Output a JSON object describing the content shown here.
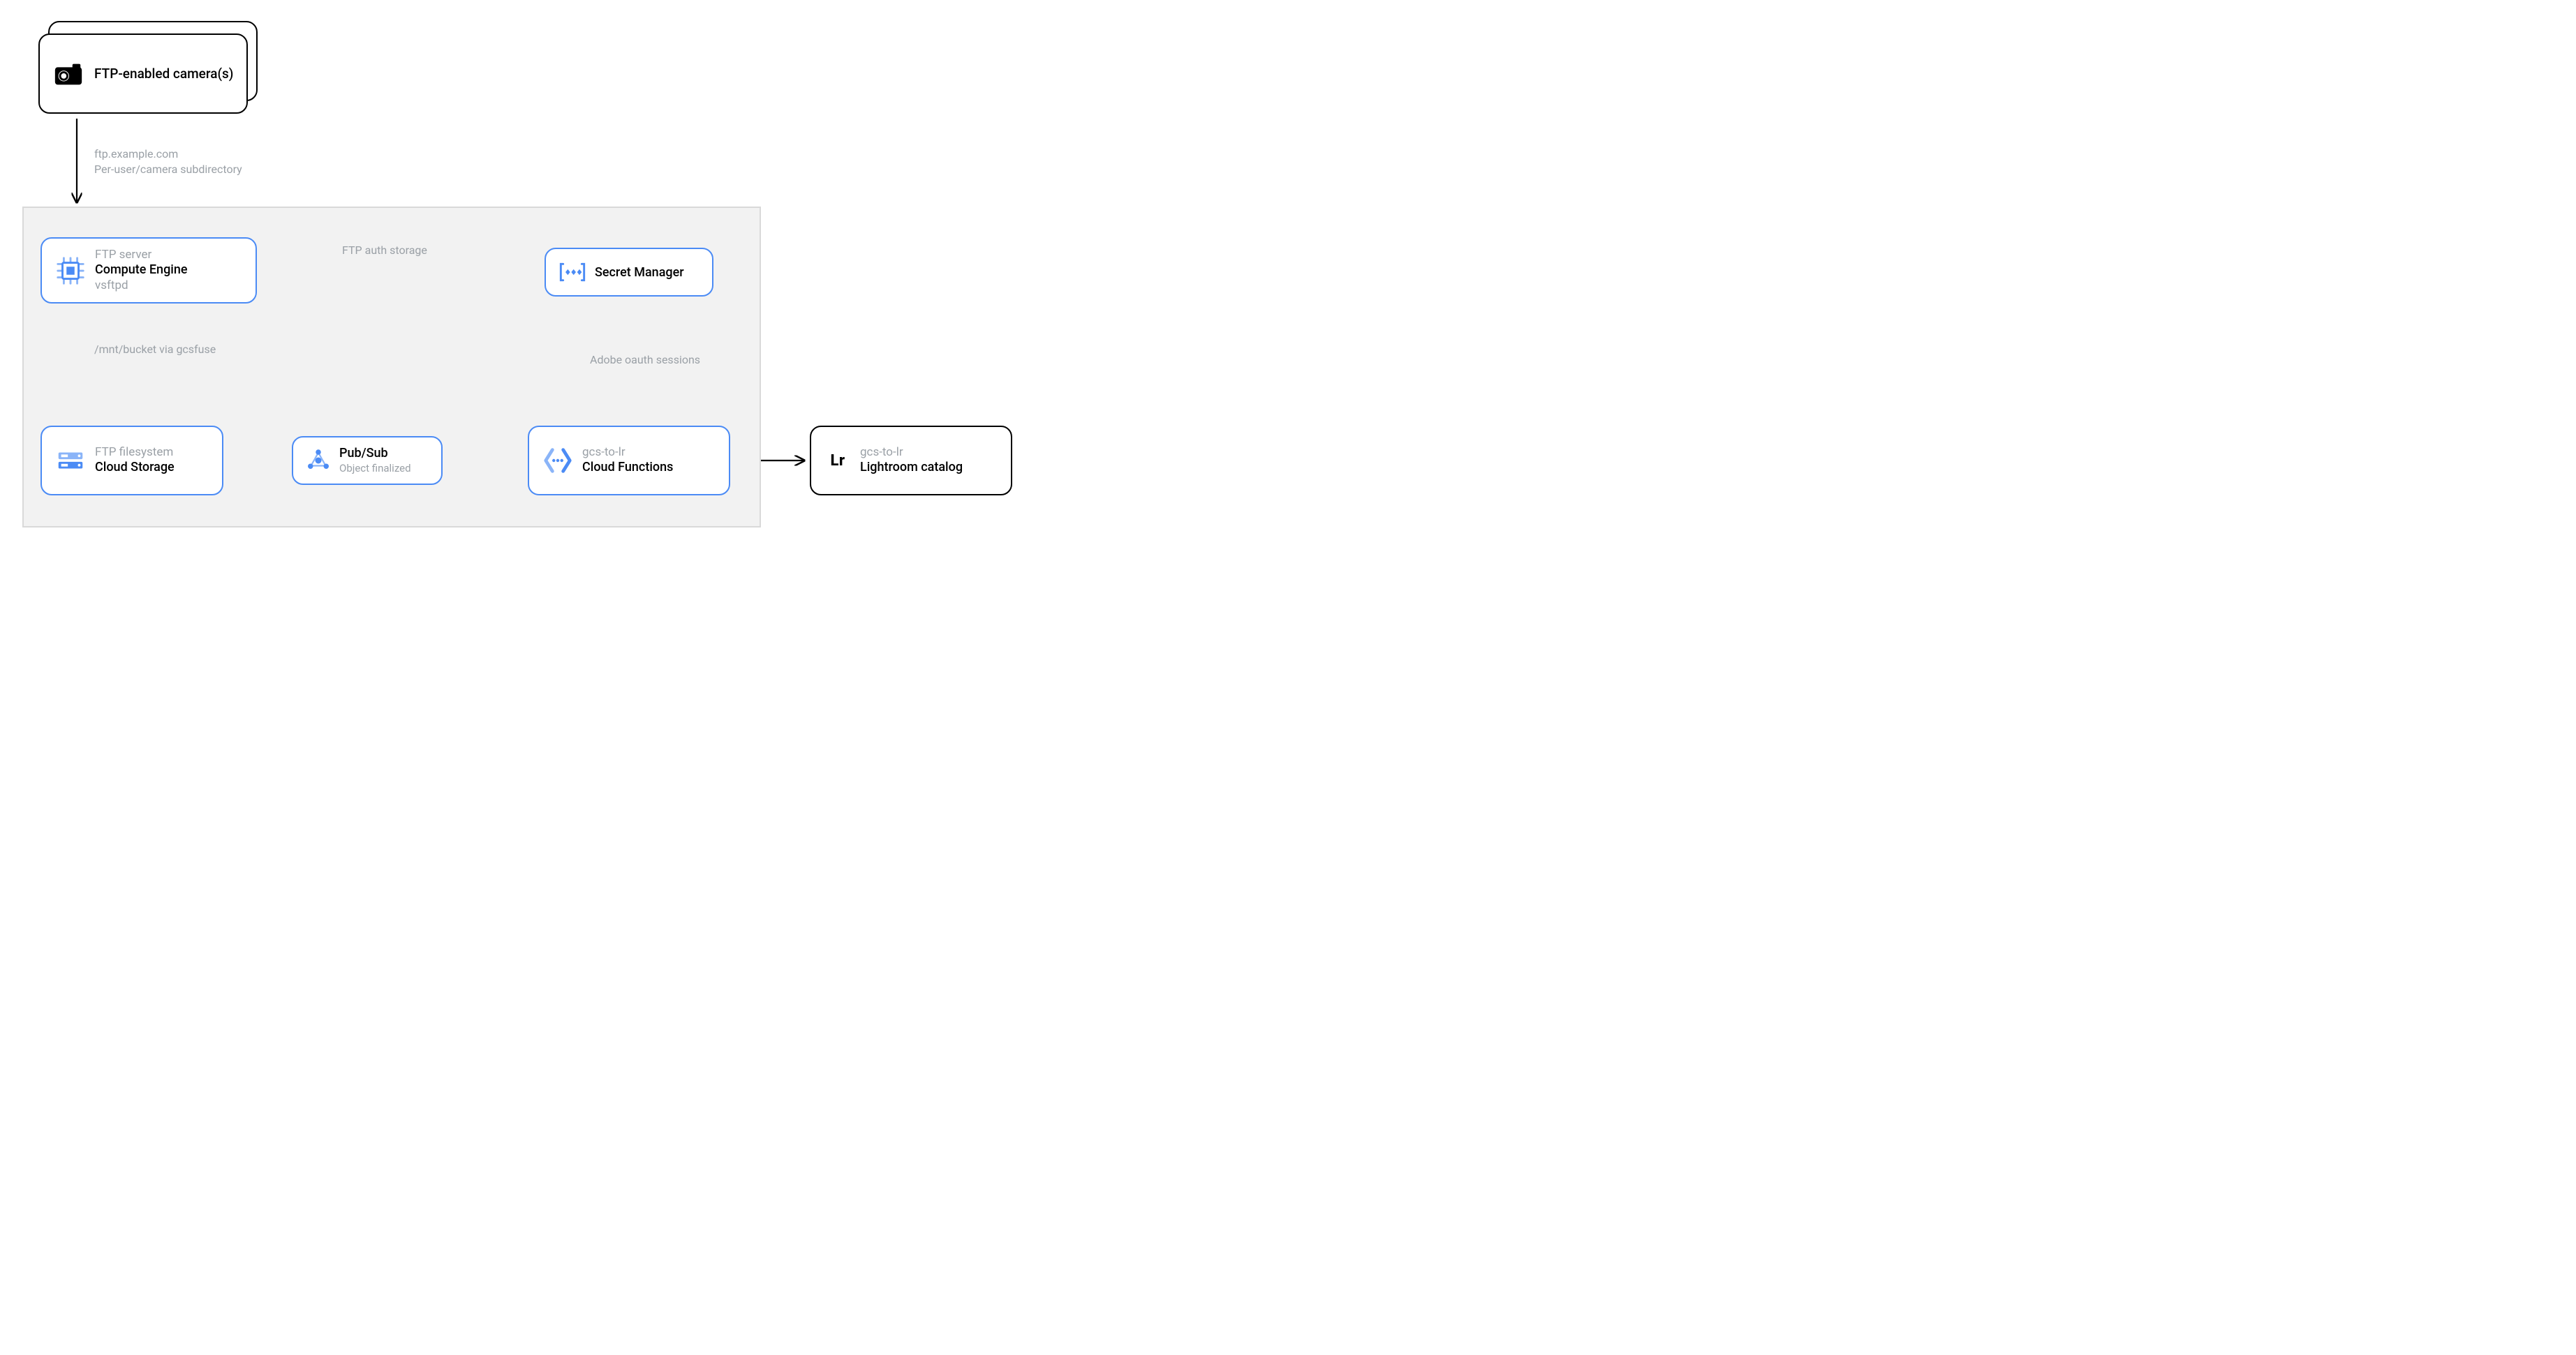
{
  "nodes": {
    "camera": {
      "title": "FTP-enabled camera(s)"
    },
    "compute": {
      "over": "FTP server",
      "title": "Compute Engine",
      "under": "vsftpd"
    },
    "secret": {
      "title": "Secret Manager"
    },
    "storage": {
      "over": "FTP filesystem",
      "title": "Cloud Storage"
    },
    "pubsub": {
      "title": "Pub/Sub",
      "under": "Object finalized"
    },
    "functions": {
      "over": "gcs-to-lr",
      "title": "Cloud Functions"
    },
    "lightroom": {
      "over": "gcs-to-lr",
      "title": "Lightroom catalog",
      "badge": "Lr"
    }
  },
  "edges": {
    "camera_compute": {
      "l1": "ftp.example.com",
      "l2": "Per-user/camera subdirectory"
    },
    "compute_secret": "FTP auth storage",
    "compute_storage": "/mnt/bucket via gcsfuse",
    "secret_functions": "Adobe oauth sessions"
  }
}
